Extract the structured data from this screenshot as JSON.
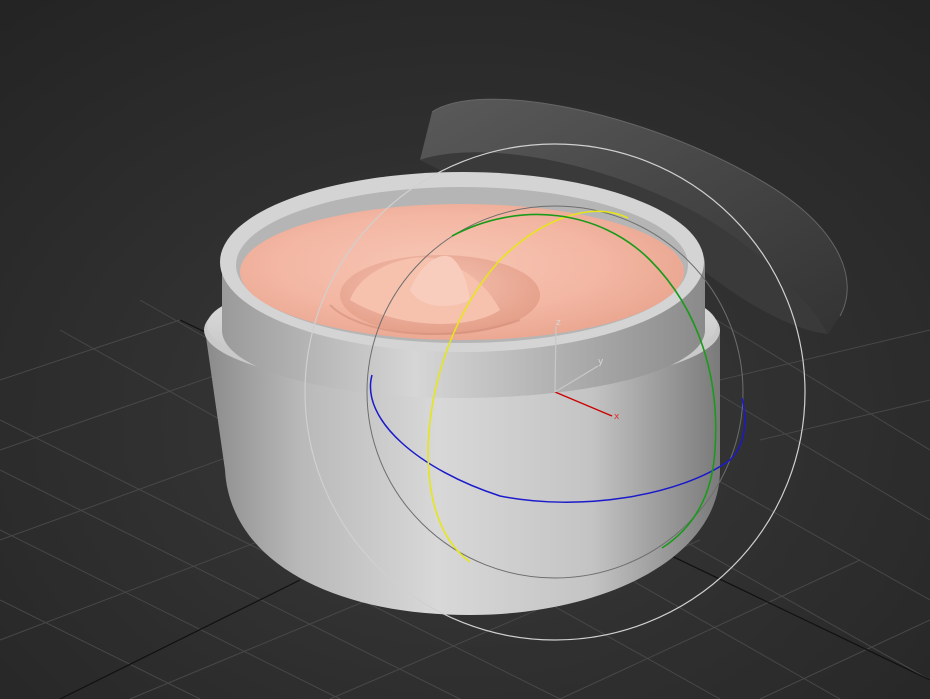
{
  "viewport": {
    "axis_labels": {
      "x": "x",
      "y": "y",
      "z": "z"
    },
    "colors": {
      "background_top": "#272727",
      "background_bottom": "#3c3c3c",
      "grid": "#4a4a4a",
      "grid_center": "#111111",
      "jar": "#cfcfcf",
      "cream": "#f2b3a0",
      "lid": "#4a4a4a",
      "gizmo_x": "#cc0000",
      "gizmo_y": "#c8c8c8",
      "gizmo_z": "#c8c8c8",
      "rotate_z_ring": "#1a1acc",
      "rotate_x_ring": "#e6e61a",
      "rotate_y_ring": "#1a9a1a",
      "screen_ring": "#d0d0d0",
      "arcball_ring": "#6a6a6a"
    },
    "objects": [
      "jar-body",
      "cream",
      "lid",
      "rotate-gizmo"
    ]
  }
}
